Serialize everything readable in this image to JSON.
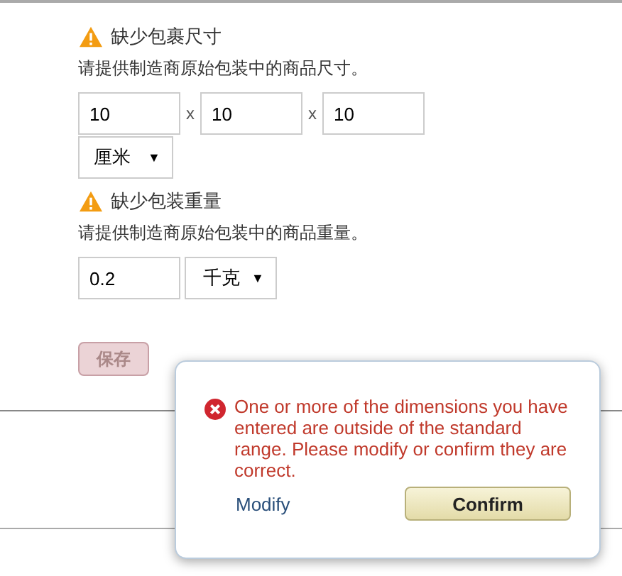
{
  "dimensions": {
    "warning": "缺少包裹尺寸",
    "hint": "请提供制造商原始包装中的商品尺寸。",
    "values": [
      "10",
      "10",
      "10"
    ],
    "separators": [
      "x",
      "x"
    ],
    "unit": "厘米",
    "dropdown_arrow": "▼"
  },
  "weight": {
    "warning": "缺少包装重量",
    "hint": "请提供制造商原始包装中的商品重量。",
    "value": "0.2",
    "unit": "千克",
    "dropdown_arrow": "▼"
  },
  "save_button": {
    "label": "保存",
    "disabled": true
  },
  "popup": {
    "message": "One or more of the dimensions you have entered are outside of the standard range. Please modify or confirm they are correct.",
    "modify_link": "Modify",
    "confirm_button": "Confirm"
  }
}
